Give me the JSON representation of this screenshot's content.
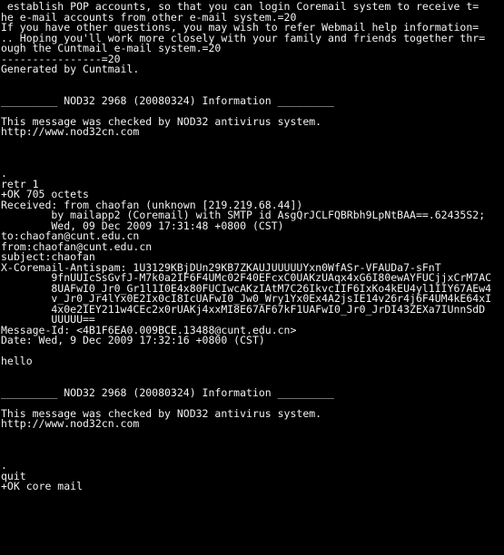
{
  "terminal": {
    "type": "pop3-session-console",
    "background_color": "#000000",
    "foreground_color": "#f2f2f2",
    "columns": 78,
    "rows": 53,
    "lines": [
      " establish POP accounts, so that you can login Coremail system to receive t=",
      "he e-mail accounts from other e-mail system.=20",
      "If you have other questions, you may wish to refer Webmail help information=",
      ".. Hoping you'll work more closely with your family and friends together thr=",
      "ough the Cuntmail e-mail system.=20",
      "----------------=20",
      "Generated by Cuntmail.",
      "",
      "",
      "_________ NOD32 2968 (20080324) Information _________",
      "",
      "This message was checked by NOD32 antivirus system.",
      "http://www.nod32cn.com",
      "",
      "",
      "",
      ".",
      "retr 1",
      "+OK 705 octets",
      "Received: from chaofan (unknown [219.219.68.44])",
      "        by mailapp2 (Coremail) with SMTP id AsgQrJCLFQBRbh9LpNtBAA==.62435S2;",
      "        Wed, 09 Dec 2009 17:31:48 +0800 (CST)",
      "to:chaofan@cunt.edu.cn",
      "from:chaofan@cunt.edu.cn",
      "subject:chaofan",
      "X-Coremail-Antispam: 1U3129KBjDUn29KB7ZKAUJUUUUUYxn0WfASr-VFAUDa7-sFnT",
      "        9fnUUIcSsGvfJ-M7k0a2IF6F4UMc02F40EFcxC0UAKzUAqx4xG6I80ewAYFUCjjxCrM7AC",
      "        8UAFwI0_Jr0_Gr1l1I0E4x80FUCIwcAKzIAtM7C26IkvcIIF6IxKo4kEU4yl1IIY67AEw4",
      "        v_Jr0_Jr4lYx0E2Ix0cI8IcUAFwI0_Jw0_Wry1Yx0Ex4A2jsIE14v26r4j6F4UM4kE64xI",
      "        4x0e2IEY211w4CEc2x0rUAKj4xxMI8E67AF67kF1UAFwI0_Jr0_JrDI43ZEXa7IUnnSdD",
      "        UUUUU==",
      "Message-Id: <4B1F6EA0.009BCE.13488@cunt.edu.cn>",
      "Date: Wed, 9 Dec 2009 17:32:16 +0800 (CST)",
      "",
      "hello",
      "",
      "",
      "_________ NOD32 2968 (20080324) Information _________",
      "",
      "This message was checked by NOD32 antivirus system.",
      "http://www.nod32cn.com",
      "",
      "",
      "",
      ".",
      "quit",
      "+OK core mail"
    ],
    "commands": {
      "retr": "retr 1",
      "quit": "quit"
    },
    "responses": {
      "retr_ok": "+OK 705 octets",
      "quit_ok": "+OK core mail",
      "end_of_message_marker": "."
    },
    "mail_headers": {
      "to": "to:chaofan@cunt.edu.cn",
      "from": "from:chaofan@cunt.edu.cn",
      "subject": "subject:chaofan",
      "message_id": "Message-Id: <4B1F6EA0.009BCE.13488@cunt.edu.cn>",
      "date": "Date: Wed, 9 Dec 2009 17:32:16 +0800 (CST)"
    },
    "mail_body": "hello",
    "antivirus_banner": {
      "title": "_________ NOD32 2968 (20080324) Information _________",
      "text": "This message was checked by NOD32 antivirus system.",
      "url": "http://www.nod32cn.com"
    }
  }
}
